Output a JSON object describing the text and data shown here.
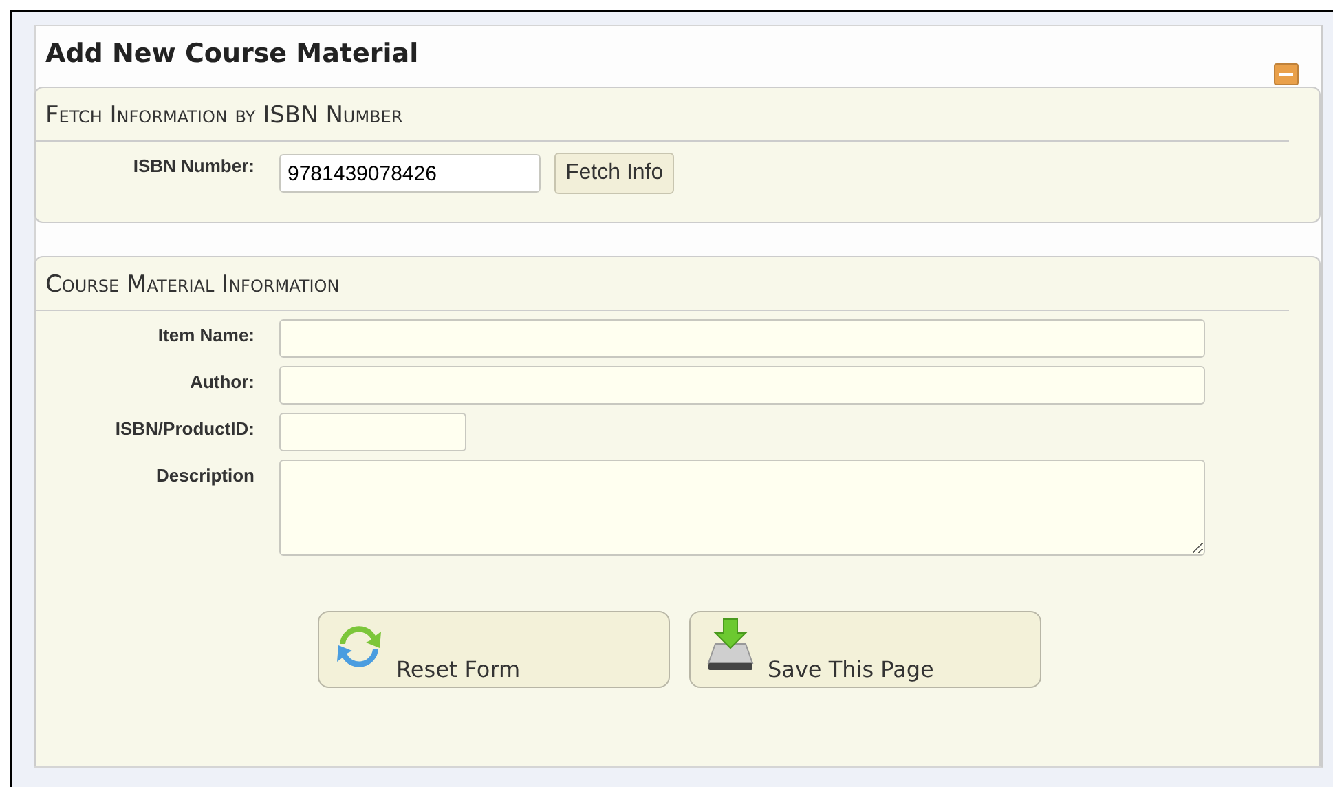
{
  "panel": {
    "title": "Add New Course Material"
  },
  "fetch_section": {
    "heading": "Fetch Information by ISBN Number",
    "label": "ISBN Number:",
    "value": "9781439078426",
    "button": "Fetch Info"
  },
  "info_section": {
    "heading": "Course Material Information",
    "fields": [
      {
        "label": "Item Name:",
        "kind": "wide"
      },
      {
        "label": "Author:",
        "kind": "wide"
      },
      {
        "label": "ISBN/ProductID:",
        "kind": "short"
      },
      {
        "label": "Description",
        "kind": "area"
      }
    ],
    "buttons": [
      {
        "label": "Reset Form",
        "kind": "reset"
      },
      {
        "label": "Save This Page",
        "kind": "save"
      }
    ]
  }
}
